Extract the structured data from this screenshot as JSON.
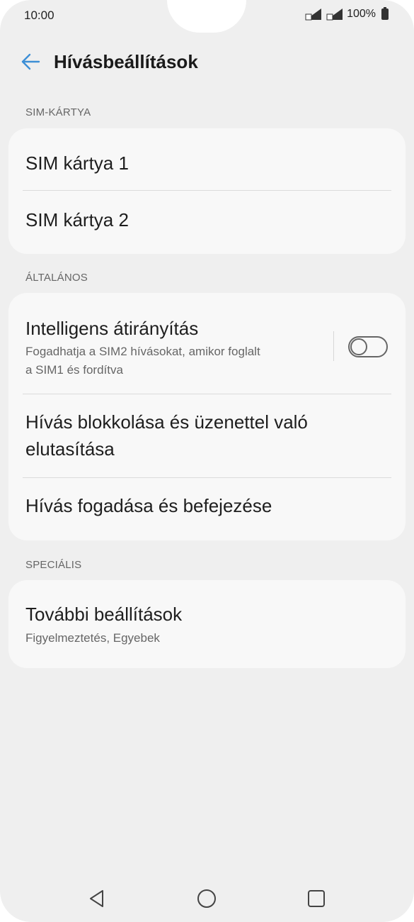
{
  "status": {
    "time": "10:00",
    "battery": "100%"
  },
  "appbar": {
    "title": "Hívásbeállítások"
  },
  "sections": {
    "sim": {
      "header": "SIM-KÁRTYA",
      "items": [
        "SIM kártya 1",
        "SIM kártya 2"
      ]
    },
    "general": {
      "header": "ÁLTALÁNOS",
      "smart_forward": {
        "title": "Intelligens átirányítás",
        "subtitle_line1": "Fogadhatja a SIM2 hívásokat, amikor foglalt",
        "subtitle_line2": "a SIM1 és fordítva",
        "toggle_on": false
      },
      "block": {
        "line1": "Hívás blokkolása és üzenettel való",
        "line2": "elutasítása"
      },
      "answer": "Hívás fogadása és befejezése"
    },
    "special": {
      "header": "SPECIÁLIS",
      "more": {
        "title": "További beállítások",
        "subtitle": "Figyelmeztetés, Egyebek"
      }
    }
  },
  "colors": {
    "accent": "#3d8fd6",
    "background": "#efefef",
    "card": "#f8f8f8"
  },
  "icons": {
    "back": "arrow-left",
    "nav_back": "triangle-left",
    "nav_home": "circle",
    "nav_recent": "square"
  }
}
